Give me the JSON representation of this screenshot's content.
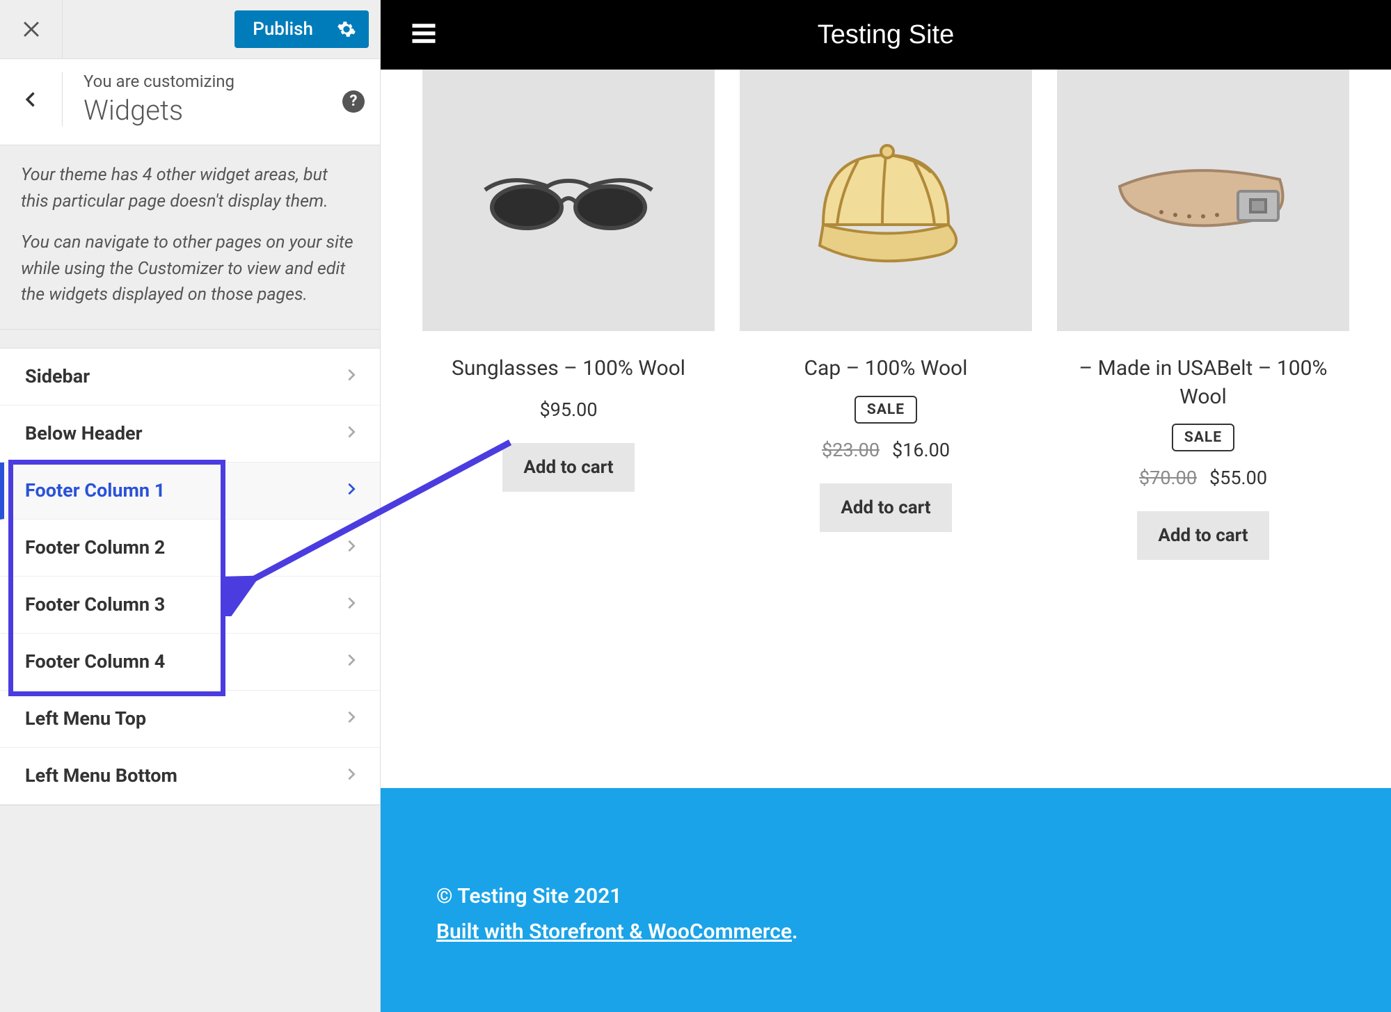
{
  "customizer": {
    "publish_label": "Publish",
    "customizing_label": "You are customizing",
    "panel_title": "Widgets",
    "notice_line1": "Your theme has 4 other widget areas, but this particular page doesn't display them.",
    "notice_line2": "You can navigate to other pages on your site while using the Customizer to view and edit the widgets displayed on those pages.",
    "items": [
      {
        "label": "Sidebar",
        "active": false
      },
      {
        "label": "Below Header",
        "active": false
      },
      {
        "label": "Footer Column 1",
        "active": true
      },
      {
        "label": "Footer Column 2",
        "active": false
      },
      {
        "label": "Footer Column 3",
        "active": false
      },
      {
        "label": "Footer Column 4",
        "active": false
      },
      {
        "label": "Left Menu Top",
        "active": false
      },
      {
        "label": "Left Menu Bottom",
        "active": false
      }
    ]
  },
  "preview": {
    "site_title": "Testing Site",
    "products": [
      {
        "title": "Sunglasses – 100% Wool",
        "sale": false,
        "price_old": "",
        "price": "$95.00",
        "cart_label": "Add to cart",
        "img": "sunglasses"
      },
      {
        "title": "Cap – 100% Wool",
        "sale": true,
        "sale_label": "SALE",
        "price_old": "$23.00",
        "price": "$16.00",
        "cart_label": "Add to cart",
        "img": "cap"
      },
      {
        "title": "– Made in USABelt – 100% Wool",
        "sale": true,
        "sale_label": "SALE",
        "price_old": "$70.00",
        "price": "$55.00",
        "cart_label": "Add to cart",
        "img": "belt"
      }
    ],
    "footer": {
      "copyright": "© Testing Site 2021",
      "credit": "Built with Storefront & WooCommerce",
      "credit_suffix": "."
    }
  }
}
